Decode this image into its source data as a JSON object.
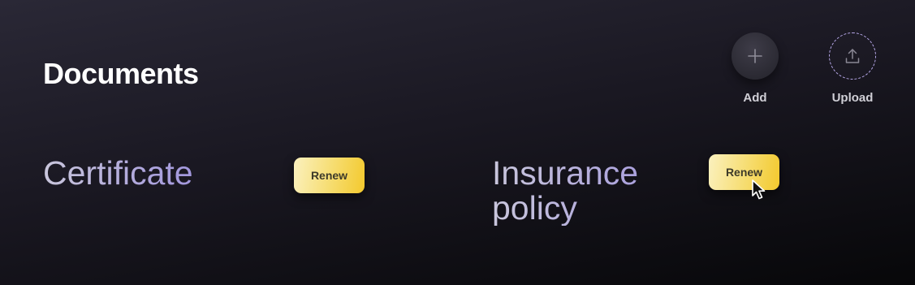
{
  "header": {
    "title": "Documents"
  },
  "actions": {
    "add": {
      "label": "Add",
      "icon": "plus-icon"
    },
    "upload": {
      "label": "Upload",
      "icon": "upload-icon"
    }
  },
  "documents": [
    {
      "name": "Certificate",
      "button_label": "Renew"
    },
    {
      "name": "Insurance policy",
      "button_label": "Renew"
    }
  ],
  "colors": {
    "accent_purple": "#b7a8ea",
    "button_yellow": "#f3c92d",
    "text_white": "#ffffff"
  }
}
